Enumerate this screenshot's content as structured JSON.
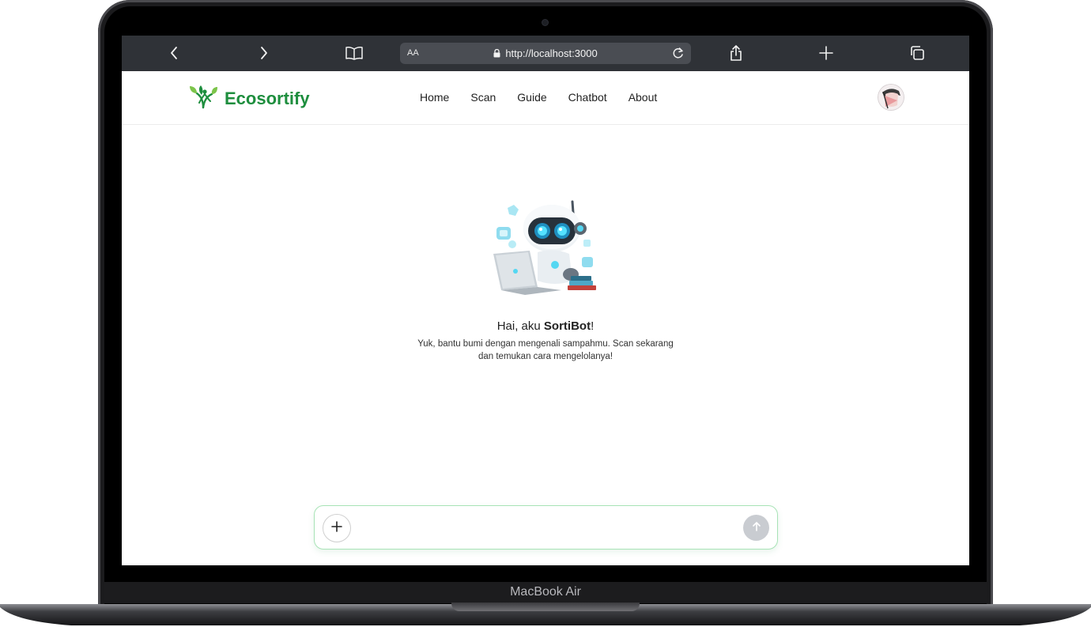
{
  "device": {
    "label": "MacBook Air"
  },
  "browser": {
    "text_size_label": "AA",
    "url": "http://localhost:3000",
    "icons": [
      "back-icon",
      "forward-icon",
      "bookmarks-icon",
      "lock-icon",
      "reload-icon",
      "share-icon",
      "new-tab-icon",
      "tabs-icon"
    ]
  },
  "app": {
    "brand": "Ecosortify",
    "brand_color": "#1e8e3e",
    "nav": [
      {
        "label": "Home"
      },
      {
        "label": "Scan"
      },
      {
        "label": "Guide"
      },
      {
        "label": "Chatbot"
      },
      {
        "label": "About"
      }
    ]
  },
  "welcome": {
    "greeting_prefix": "Hai, aku ",
    "bot_name": "SortiBot",
    "greeting_suffix": "!",
    "subtitle": "Yuk, bantu bumi dengan mengenali sampahmu. Scan sekarang dan temukan cara mengelolanya!"
  },
  "chat_input": {
    "value": "",
    "placeholder": "",
    "icons": [
      "plus-icon",
      "send-arrow-icon"
    ],
    "accent_border": "#a8e3b6"
  }
}
